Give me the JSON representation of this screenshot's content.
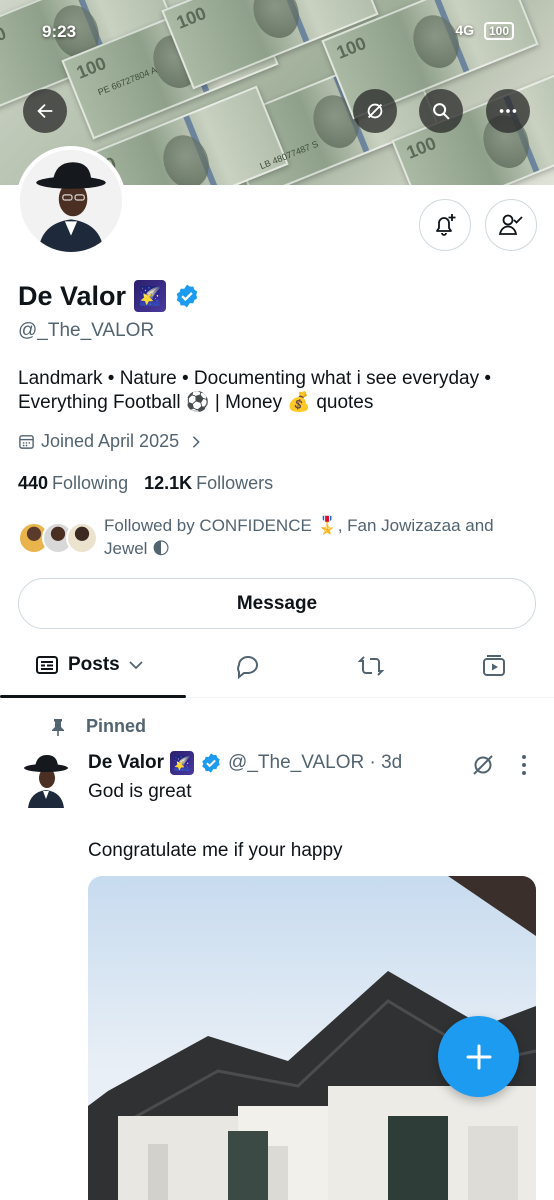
{
  "status_bar": {
    "time": "9:23",
    "network": "4G",
    "battery": "100"
  },
  "banner": {
    "bill_label": "100",
    "serials": [
      "PE 66727804 A",
      "LB 48077487 S"
    ]
  },
  "profile": {
    "name": "De Valor",
    "name_emoji": "🌠",
    "handle": "@_The_VALOR",
    "bio_line1": "Landmark • Nature • Documenting what i see everyday •",
    "bio_line2": "Everything Football ⚽ | Money 💰 quotes",
    "joined": "Joined April 2025",
    "following_count": "440",
    "following_label": "Following",
    "followers_count": "12.1K",
    "followers_label": "Followers",
    "followed_by_line1": "Followed by CONFIDENCE 🎖️, Fan Jowizazaa and",
    "followed_by_line2": "Jewel 🌓",
    "message_label": "Message"
  },
  "tabs": {
    "posts_label": "Posts"
  },
  "tweet": {
    "pinned_label": "Pinned",
    "author_name": "De Valor",
    "author_emoji": "🌠",
    "meta": "@_The_VALOR · 3d",
    "text_line1": "God is great",
    "text_line2": "Congratulate me if your happy"
  },
  "colors": {
    "accent": "#1d9bf0",
    "text": "#0f1419",
    "muted": "#536471",
    "border": "#cfd9de"
  },
  "icons": {
    "back": "back-arrow-icon",
    "grok": "grok-icon",
    "search": "search-icon",
    "more": "more-icon",
    "bell_add": "bell-plus-icon",
    "follow_check": "person-check-icon",
    "calendar": "calendar-icon",
    "posts": "posts-icon",
    "reply": "reply-icon",
    "repost": "repost-icon",
    "media": "media-icon",
    "pin": "pin-icon",
    "compose": "plus-icon"
  }
}
